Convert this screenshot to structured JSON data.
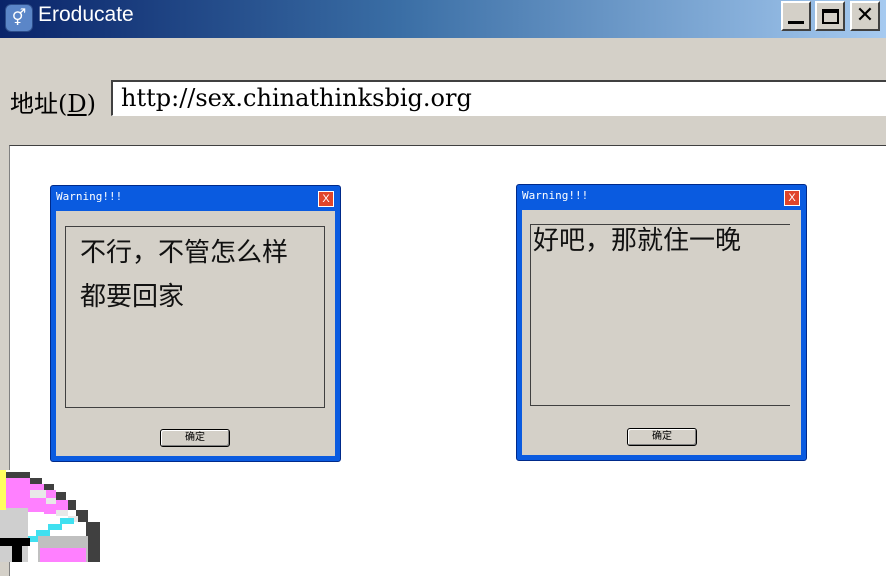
{
  "window": {
    "title": "Eroducate"
  },
  "address": {
    "label_prefix": "地址(",
    "label_key": "D",
    "label_suffix": ")",
    "url": "http://sex.chinathinksbig.org"
  },
  "dialogs": [
    {
      "title": "Warning!!!",
      "close": "X",
      "message_line1": "不行，不管怎么样",
      "message_line2": "都要回家",
      "ok": "确定"
    },
    {
      "title": "Warning!!!",
      "close": "X",
      "message_line1": "好吧，那就住一晚",
      "ok": "确定"
    }
  ],
  "colors": {
    "titlebar_start": "#0a246a",
    "dialog_frame": "#0a5be0",
    "dialog_close": "#e0452a"
  }
}
